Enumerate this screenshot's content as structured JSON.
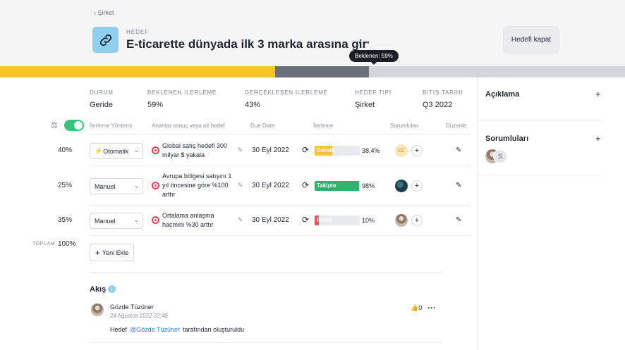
{
  "header": {
    "back_label": "Şirket",
    "kicker": "HEDEF",
    "title": "E-ticarette dünyada ilk 3 marka arasına gir",
    "more": "···",
    "close_button": "Hedefi kapat"
  },
  "tooltip": {
    "text": "Beklenen: 59%"
  },
  "progress": {
    "actual_fraction": 0.43,
    "expected_fraction": 0.59,
    "actual_color": "#f7c52b",
    "expected_color": "#6b6f79",
    "track_color": "#d3d5da"
  },
  "stats": [
    {
      "label": "DURUM",
      "value": "Geride"
    },
    {
      "label": "BEKLENEN İLERLEME",
      "value": "59%"
    },
    {
      "label": "GERÇEKLEŞEN İLERLEME",
      "value": "43%"
    },
    {
      "label": "HEDEF TIPI",
      "value": "Şirket"
    },
    {
      "label": "BITIŞ TARIHI",
      "value": "Q3 2022"
    }
  ],
  "columns": {
    "method": "İlerleme Yöntemi",
    "key_result": "Anahtar sonuç veya alt hedef",
    "due": "Due Date",
    "progress": "İlerleme",
    "owners": "Sorumluları",
    "edit": "Düzenle"
  },
  "rows": [
    {
      "weight": "40%",
      "method": "Otomatik",
      "auto": "⚡",
      "name": "Global satış hedefi 300 milyar $ yakala",
      "due": "30 Eyl 2022",
      "status": "Geride",
      "status_color": "#f7c52b",
      "progress_fraction": 0.384,
      "percent": "38.4%",
      "owner_initials": "CC"
    },
    {
      "weight": "25%",
      "method": "Manuel",
      "auto": "",
      "name": "Avrupa bölgesi satışını 1 yıl öncesine göre %100 arttır",
      "due": "30 Eyl 2022",
      "status": "Takipte",
      "status_color": "#2fb36b",
      "progress_fraction": 0.98,
      "percent": "98%",
      "owner_initials": ""
    },
    {
      "weight": "35%",
      "method": "Manuel",
      "auto": "",
      "name": "Ortalama anlaşma hacmini %30 arttır",
      "due": "30 Eyl 2022",
      "status": "Riskli",
      "status_color": "#e8525a",
      "progress_fraction": 0.1,
      "percent": "10%",
      "owner_initials": ""
    }
  ],
  "total": {
    "label": "TOPLAM",
    "value": "100%"
  },
  "add_new": "Yeni Ekle",
  "feed": {
    "title": "Akış",
    "info_icon": "i",
    "author": "Gözde Tüzüner",
    "date": "24 Ağustos 2022 22:48",
    "text_prefix": "Hedef",
    "mention": "@Gözde Tüzüner",
    "text_suffix": "tarafından oluşturuldu",
    "likes": "0"
  },
  "side_panel": {
    "description_title": "Açıklama",
    "owners_title": "Sorumluları",
    "owner_initial": "S"
  },
  "icons": {
    "back": "chevron-left-icon",
    "goal": "link-icon",
    "scale": "scale-icon",
    "target": "target-icon",
    "sync": "sync-icon",
    "pencil": "pencil-icon",
    "plus": "plus-icon",
    "like": "thumbs-up-icon"
  }
}
